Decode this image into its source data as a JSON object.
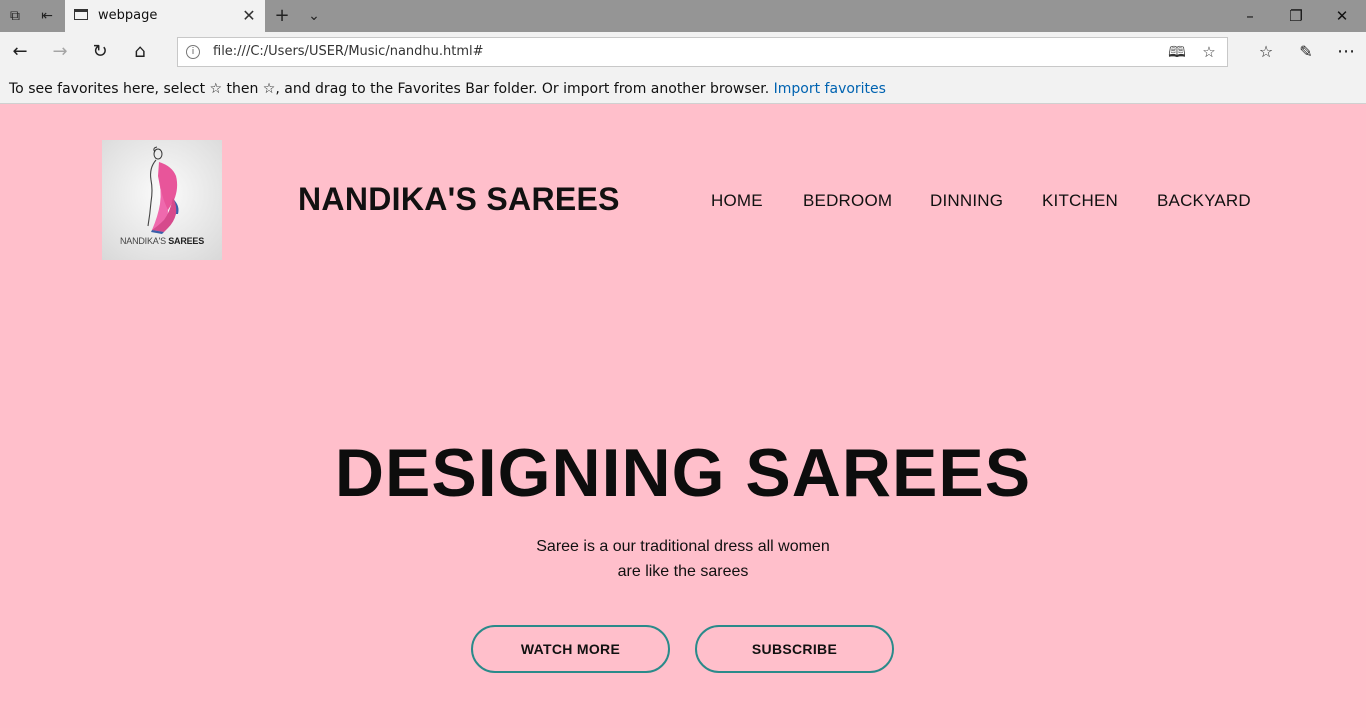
{
  "browser": {
    "tab_title": "webpage",
    "address": "file:///C:/Users/USER/Music/nandhu.html#",
    "favorites_prompt": "To see favorites here, select ☆ then ☆, and drag to the Favorites Bar folder. Or import from another browser.",
    "import_favorites_link": "Import favorites"
  },
  "site": {
    "logo_caption_light": "NANDIKA'S",
    "logo_caption_bold": "SAREES",
    "brand": "NANDIKA'S SAREES",
    "nav": [
      "HOME",
      "BEDROOM",
      "DINNING",
      "KITCHEN",
      "BACKYARD"
    ]
  },
  "hero": {
    "title": "DESIGNING SAREES",
    "text_line1": "Saree is a our traditional dress all women",
    "text_line2": "are like the sarees",
    "watch_more_label": "WATCH MORE",
    "subscribe_label": "SUBSCRIBE"
  },
  "colors": {
    "page_background": "#ffbfcb",
    "button_border": "#2a8a8a",
    "link": "#0063b1"
  }
}
